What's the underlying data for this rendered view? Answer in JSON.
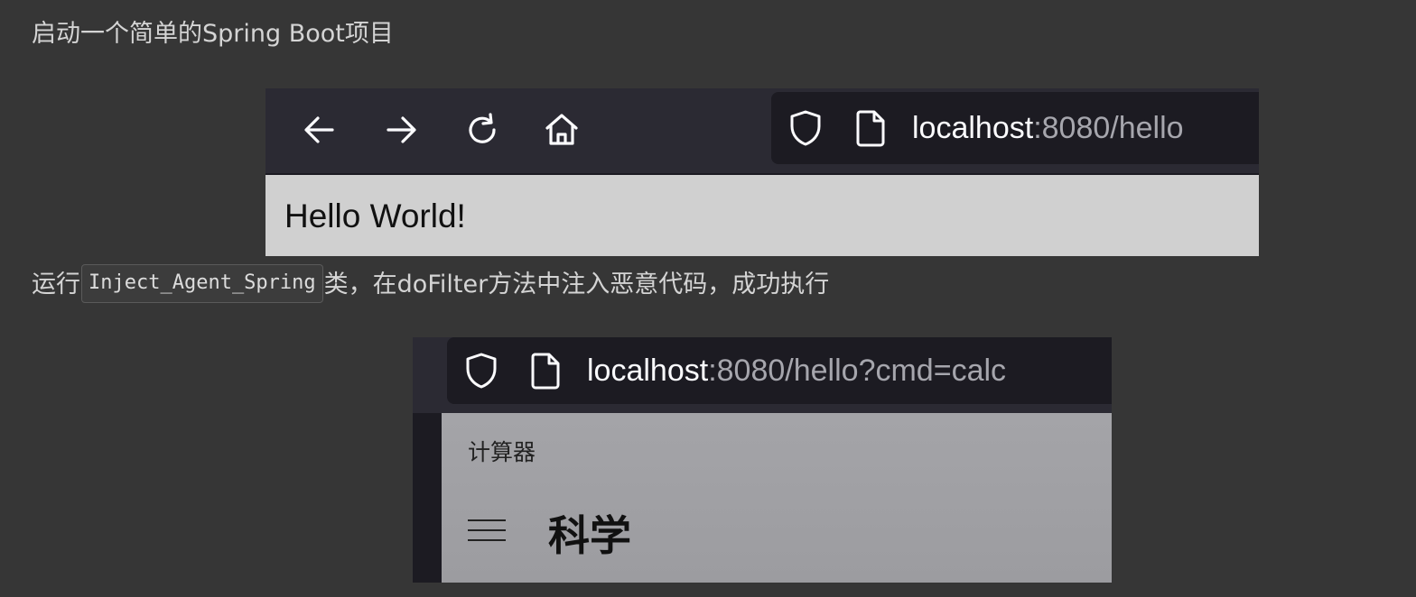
{
  "paragraphs": {
    "p1": "启动一个简单的Spring Boot项目",
    "p2_before": "运行",
    "p2_code": "Inject_Agent_Spring",
    "p2_after": "类，在doFilter方法中注入恶意代码，成功执行"
  },
  "screenshot1": {
    "url_host": "localhost",
    "url_rest": ":8080/hello",
    "page_text": "Hello World!",
    "icons": [
      "back-arrow-icon",
      "forward-arrow-icon",
      "reload-icon",
      "home-icon",
      "shield-icon",
      "page-icon"
    ]
  },
  "screenshot2": {
    "url_host": "localhost",
    "url_rest": ":8080/hello?cmd=calc",
    "app_title": "计算器",
    "mode_title": "科学",
    "icons": [
      "shield-icon",
      "page-icon",
      "hamburger-menu-icon"
    ]
  },
  "colors": {
    "page_bg": "#363636",
    "toolbar_bg": "#2b2a33",
    "urlbar_bg": "#1c1b22",
    "content_bg": "#d0d0d0",
    "calc_bg": "#a0a0a4"
  }
}
